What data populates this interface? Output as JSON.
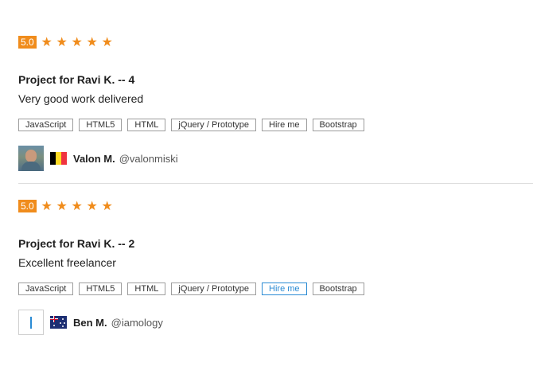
{
  "reviews": [
    {
      "rating": "5.0",
      "stars": [
        "★",
        "★",
        "★",
        "★",
        "★"
      ],
      "title": "Project for Ravi K. -- 4",
      "description": "Very good work delivered",
      "tags": [
        "JavaScript",
        "HTML5",
        "HTML",
        "jQuery / Prototype",
        "Hire me",
        "Bootstrap"
      ],
      "user": {
        "name": "Valon M.",
        "handle": "@valonmiski",
        "flag": "belgium-flag-icon"
      }
    },
    {
      "rating": "5.0",
      "stars": [
        "★",
        "★",
        "★",
        "★",
        "★"
      ],
      "title": "Project for Ravi K. -- 2",
      "description": "Excellent freelancer",
      "tags": [
        "JavaScript",
        "HTML5",
        "HTML",
        "jQuery / Prototype",
        "Hire me",
        "Bootstrap"
      ],
      "active_tag": "Hire me",
      "user": {
        "name": "Ben M.",
        "handle": "@iamology",
        "flag": "australia-flag-icon"
      }
    }
  ],
  "colors": {
    "rating_badge": "#f08c1c",
    "star": "#f08c1c",
    "active_tag": "#2a8bd4",
    "divider": "#dddddd"
  }
}
